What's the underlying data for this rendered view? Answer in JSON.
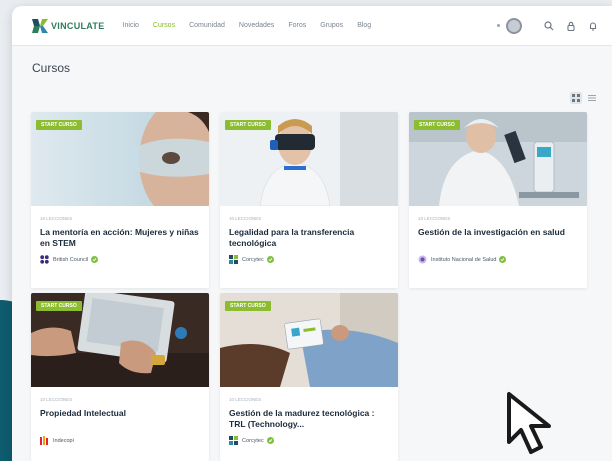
{
  "header": {
    "logo_text": "VINCULATE",
    "nav": [
      "Inicio",
      "Cursos",
      "Comunidad",
      "Novedades",
      "Foros",
      "Grupos",
      "Blog"
    ],
    "active_nav": "Cursos"
  },
  "page": {
    "title": "Cursos"
  },
  "courses": [
    {
      "badge": "START CURSO",
      "meta": "10 LECCIONES",
      "title": "La mentoría en acción: Mujeres y niñas en STEM",
      "provider": "British Council",
      "image_icon": "woman-goggles-image"
    },
    {
      "badge": "START CURSO",
      "meta": "10 LECCIONES",
      "title": "Legalidad para la transferencia tecnológica",
      "provider": "Corcytec",
      "image_icon": "vr-headset-image"
    },
    {
      "badge": "START CURSO",
      "meta": "10 LECCIONES",
      "title": "Gestión de la investigación en salud",
      "provider": "Instituto Nacional de Salud",
      "image_icon": "microscope-lab-image"
    },
    {
      "badge": "START CURSO",
      "meta": "10 LECCIONES",
      "title": "Propiedad Intelectual",
      "provider": "Indecopi",
      "image_icon": "tablet-hands-image"
    },
    {
      "badge": "START CURSO",
      "meta": "10 LECCIONES",
      "title": "Gestión de la madurez tecnológica : TRL (Technology...",
      "provider": "Corcytec",
      "image_icon": "tablet-chart-image"
    }
  ],
  "colors": {
    "accent": "#8cbc2f",
    "title_text": "#1b2a3a",
    "band": "#0f5b6f"
  }
}
